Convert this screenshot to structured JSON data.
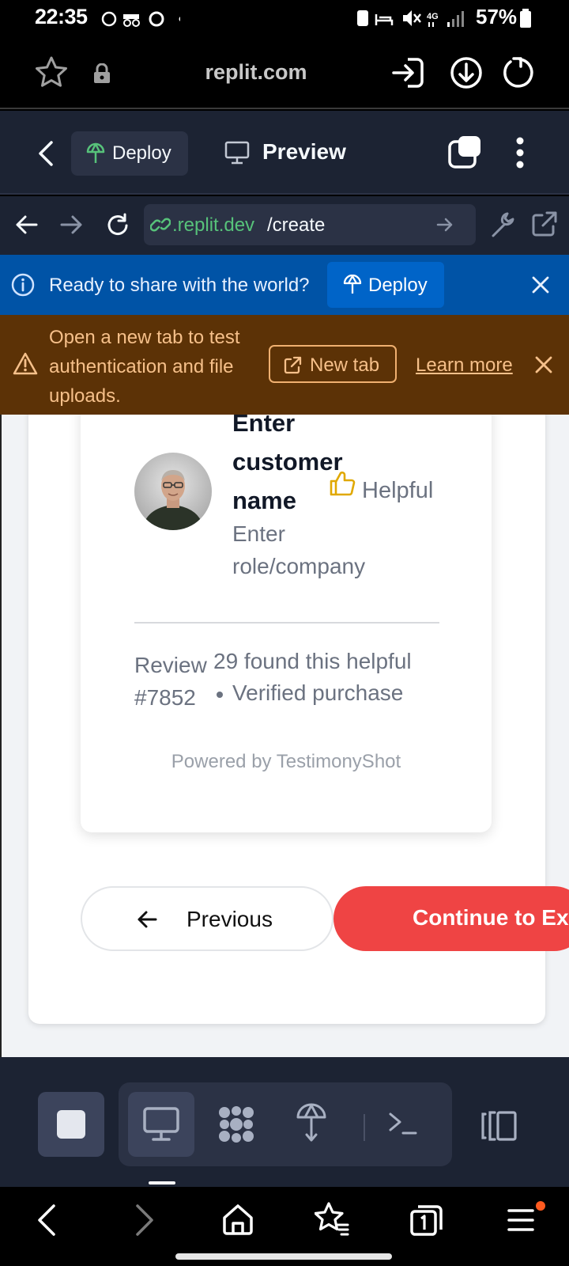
{
  "status_bar": {
    "time": "22:35",
    "network": "4G",
    "battery": "57%"
  },
  "browser": {
    "domain": "replit.com"
  },
  "replit_header": {
    "deploy_label": "Deploy",
    "preview_label": "Preview"
  },
  "url_bar": {
    "domain": ".replit.dev",
    "path": "/create"
  },
  "share_banner": {
    "message": "Ready to share with the world?",
    "deploy_label": "Deploy"
  },
  "auth_banner": {
    "message": "Open a new tab to test authentication and file uploads.",
    "new_tab_label": "New tab",
    "learn_more_label": "Learn more"
  },
  "testimonial": {
    "customer_name": "Enter customer name",
    "role_company": "Enter role/company",
    "helpful_label": "Helpful",
    "review_number": "Review #7852",
    "helpful_count": "29 found this helpful",
    "verified": "Verified purchase",
    "powered_by": "Powered by TestimonyShot"
  },
  "navigation": {
    "previous_label": "Previous",
    "continue_label": "Continue to Ex"
  },
  "colors": {
    "replit_bg": "#1c2333",
    "share_banner": "#0053a6",
    "auth_banner": "#5c3206",
    "continue_button": "#ef4444",
    "helpful_icon": "#e0a800"
  }
}
